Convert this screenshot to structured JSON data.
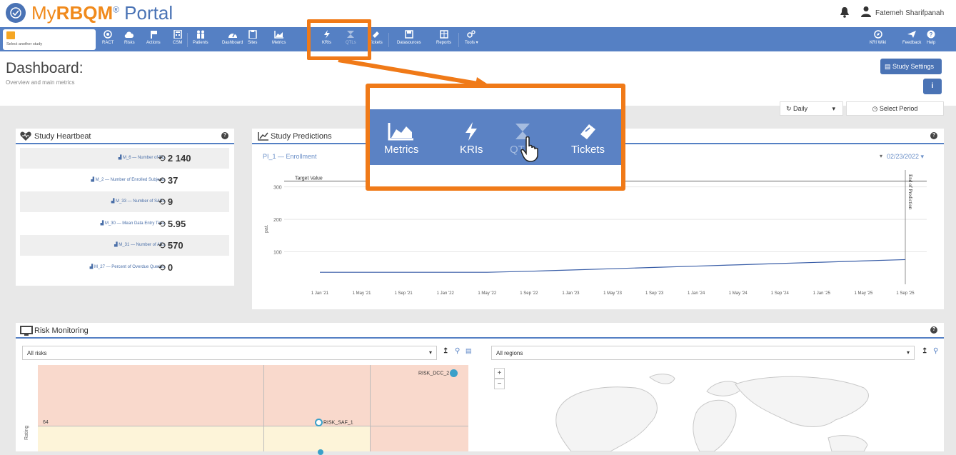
{
  "app": {
    "brand_my": "My",
    "brand_rbqm": "RBQM",
    "brand_reg": "®",
    "brand_portal": " Portal",
    "user": "Fatemeh Sharifpanah"
  },
  "nav": {
    "study_btn": "Select another study",
    "items": [
      "RACT",
      "Risks",
      "Actions",
      "CSM",
      "Patients",
      "Dashboard",
      "Sites",
      "Metrics",
      "KRIs",
      "QTLs",
      "Tickets",
      "Datasources",
      "Reports",
      "Tools ▾"
    ],
    "right": [
      "KRI Wiki",
      "Feedback",
      "Help"
    ]
  },
  "page": {
    "title": "Dashboard:",
    "subtitle": "Overview and main metrics",
    "settings": "Study Settings",
    "info": "i",
    "daily": "Daily",
    "period": "Select Period"
  },
  "heartbeat": {
    "title": "Study Heartbeat",
    "rows": [
      {
        "label": "M_6 — Number of PD",
        "value": "2 140"
      },
      {
        "label": "M_2 — Number of Enrolled Subjects",
        "value": "37"
      },
      {
        "label": "M_33 — Number of SAEs",
        "value": "9"
      },
      {
        "label": "M_30 — Mean Data Entry Time",
        "value": "5.95"
      },
      {
        "label": "M_31 — Number of AEs",
        "value": "570"
      },
      {
        "label": "M_27 — Percent of Overdue Queries",
        "value": "0"
      }
    ]
  },
  "predictions": {
    "title": "Study Predictions",
    "subtitle": "PI_1 — Enrollment",
    "date": "02/23/2022 ▾",
    "target": "Target Value",
    "end": "End of Prediction",
    "ylabel": "pat.",
    "yticks": [
      "300",
      "200",
      "100"
    ],
    "xticks": [
      "1 Jan '21",
      "1 May '21",
      "1 Sep '21",
      "1 Jan '22",
      "1 May '22",
      "1 Sep '22",
      "1 Jan '23",
      "1 May '23",
      "1 Sep '23",
      "1 Jan '24",
      "1 May '24",
      "1 Sep '24",
      "1 Jan '25",
      "1 May '25",
      "1 Sep '25"
    ]
  },
  "chart_data": {
    "type": "line",
    "xlabel": "",
    "ylabel": "pat.",
    "ylim": [
      0,
      330
    ],
    "series": [
      {
        "values": [
          37,
          37,
          37,
          37,
          37,
          40,
          44,
          48,
          52,
          56,
          60,
          64,
          68,
          72,
          76
        ]
      }
    ]
  },
  "callout": {
    "items": [
      "Metrics",
      "KRIs",
      "QTLs",
      "Tickets"
    ]
  },
  "risk": {
    "title": "Risk Monitoring",
    "filter": "All risks",
    "regions": "All regions",
    "val": "64",
    "ylabel": "Rating",
    "p1": "RISK_DCC_2",
    "p2": "RISK_SAF_1"
  },
  "colors": {
    "nav": "#5580c4",
    "accent": "#f07a18"
  }
}
